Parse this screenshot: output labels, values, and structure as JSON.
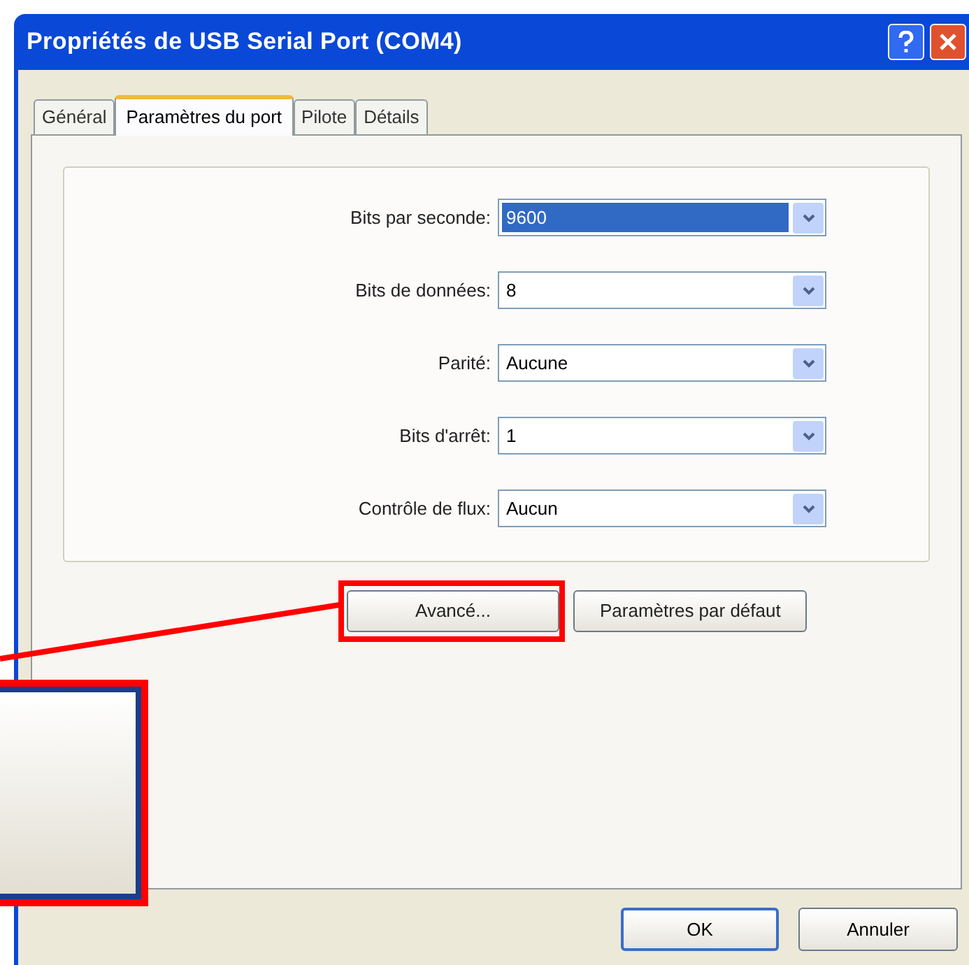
{
  "window": {
    "title": "Propriétés de USB Serial Port (COM4)"
  },
  "tabs": [
    {
      "label": "Général",
      "selected": false
    },
    {
      "label": "Paramètres du port",
      "selected": true
    },
    {
      "label": "Pilote",
      "selected": false
    },
    {
      "label": "Détails",
      "selected": false
    }
  ],
  "settings": [
    {
      "label": "Bits par seconde:",
      "value": "9600",
      "focused": true
    },
    {
      "label": "Bits de données:",
      "value": "8",
      "focused": false
    },
    {
      "label": "Parité:",
      "value": "Aucune",
      "focused": false
    },
    {
      "label": "Bits d'arrêt:",
      "value": "1",
      "focused": false
    },
    {
      "label": "Contrôle de flux:",
      "value": "Aucun",
      "focused": false
    }
  ],
  "panel_buttons": [
    {
      "label": "Avancé...",
      "highlighted": true
    },
    {
      "label": "Paramètres par défaut",
      "highlighted": false
    }
  ],
  "buttons": [
    {
      "label": "OK",
      "default": true
    },
    {
      "label": "Annuler",
      "default": false
    }
  ]
}
